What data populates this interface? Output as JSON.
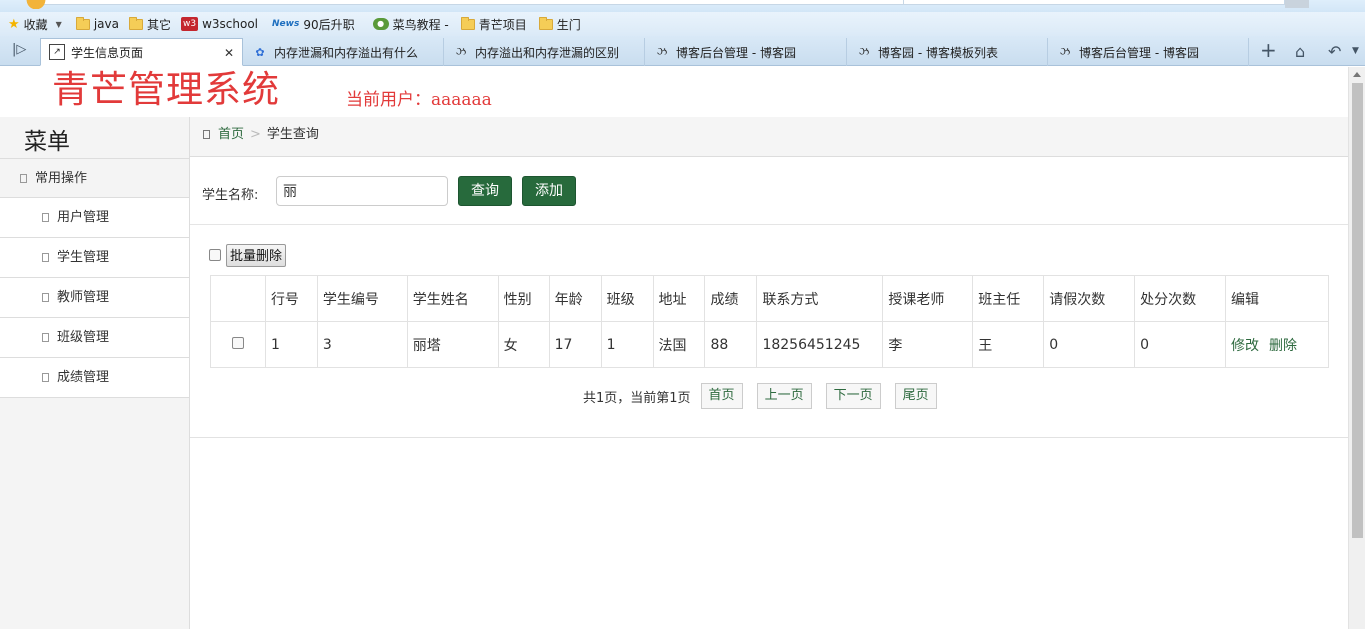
{
  "browser": {
    "bookmarks": [
      {
        "label": "收藏",
        "icon": "star-icon"
      },
      {
        "label": "java",
        "icon": "folder-icon"
      },
      {
        "label": "其它",
        "icon": "folder-icon"
      },
      {
        "label": "w3school",
        "icon": "w3school-icon"
      },
      {
        "label": "90后升职",
        "icon": "news-icon"
      },
      {
        "label": "菜鸟教程 -",
        "icon": "runoob-icon"
      },
      {
        "label": "青芒项目",
        "icon": "folder-icon"
      },
      {
        "label": "生门",
        "icon": "folder-icon"
      }
    ],
    "w3_icon_text": "w3",
    "news_icon_text": "News",
    "tabs": [
      {
        "label": "学生信息页面",
        "active": true
      },
      {
        "label": "内存泄漏和内存溢出有什么",
        "active": false
      },
      {
        "label": "内存溢出和内存泄漏的区别",
        "active": false
      },
      {
        "label": "博客后台管理 - 博客园",
        "active": false
      },
      {
        "label": "博客园 - 博客模板列表",
        "active": false
      },
      {
        "label": "博客后台管理 - 博客园",
        "active": false
      }
    ]
  },
  "header": {
    "app_title": "青芒管理系统",
    "current_user": "当前用户：aaaaaa"
  },
  "sidebar": {
    "title": "菜单",
    "group_label": "常用操作",
    "items": [
      {
        "label": "用户管理"
      },
      {
        "label": "学生管理"
      },
      {
        "label": "教师管理"
      },
      {
        "label": "班级管理"
      },
      {
        "label": "成绩管理"
      }
    ]
  },
  "breadcrumb": {
    "home": "首页",
    "current": "学生查询"
  },
  "search": {
    "label": "学生名称:",
    "value": "丽",
    "query_button": "查询",
    "add_button": "添加"
  },
  "batch_delete_label": "批量删除",
  "table": {
    "columns": [
      "",
      "行号",
      "学生编号",
      "学生姓名",
      "性别",
      "年龄",
      "班级",
      "地址",
      "成绩",
      "联系方式",
      "授课老师",
      "班主任",
      "请假次数",
      "处分次数",
      "编辑"
    ],
    "rows": [
      {
        "row_no": "1",
        "student_id": "3",
        "name": "丽塔",
        "gender": "女",
        "age": "17",
        "class": "1",
        "address": "法国",
        "score": "88",
        "phone": "18256451245",
        "teacher": "李",
        "head_teacher": "王",
        "leave_count": "0",
        "punish_count": "0",
        "edit_label": "修改",
        "delete_label": "删除"
      }
    ]
  },
  "pager": {
    "summary": "共1页，当前第1页",
    "first": "首页",
    "prev": "上一页",
    "next": "下一页",
    "last": "尾页"
  },
  "colors": {
    "title_red": "#e23a3a",
    "accent_green": "#276a3c",
    "link_green": "#2e6a3f"
  }
}
